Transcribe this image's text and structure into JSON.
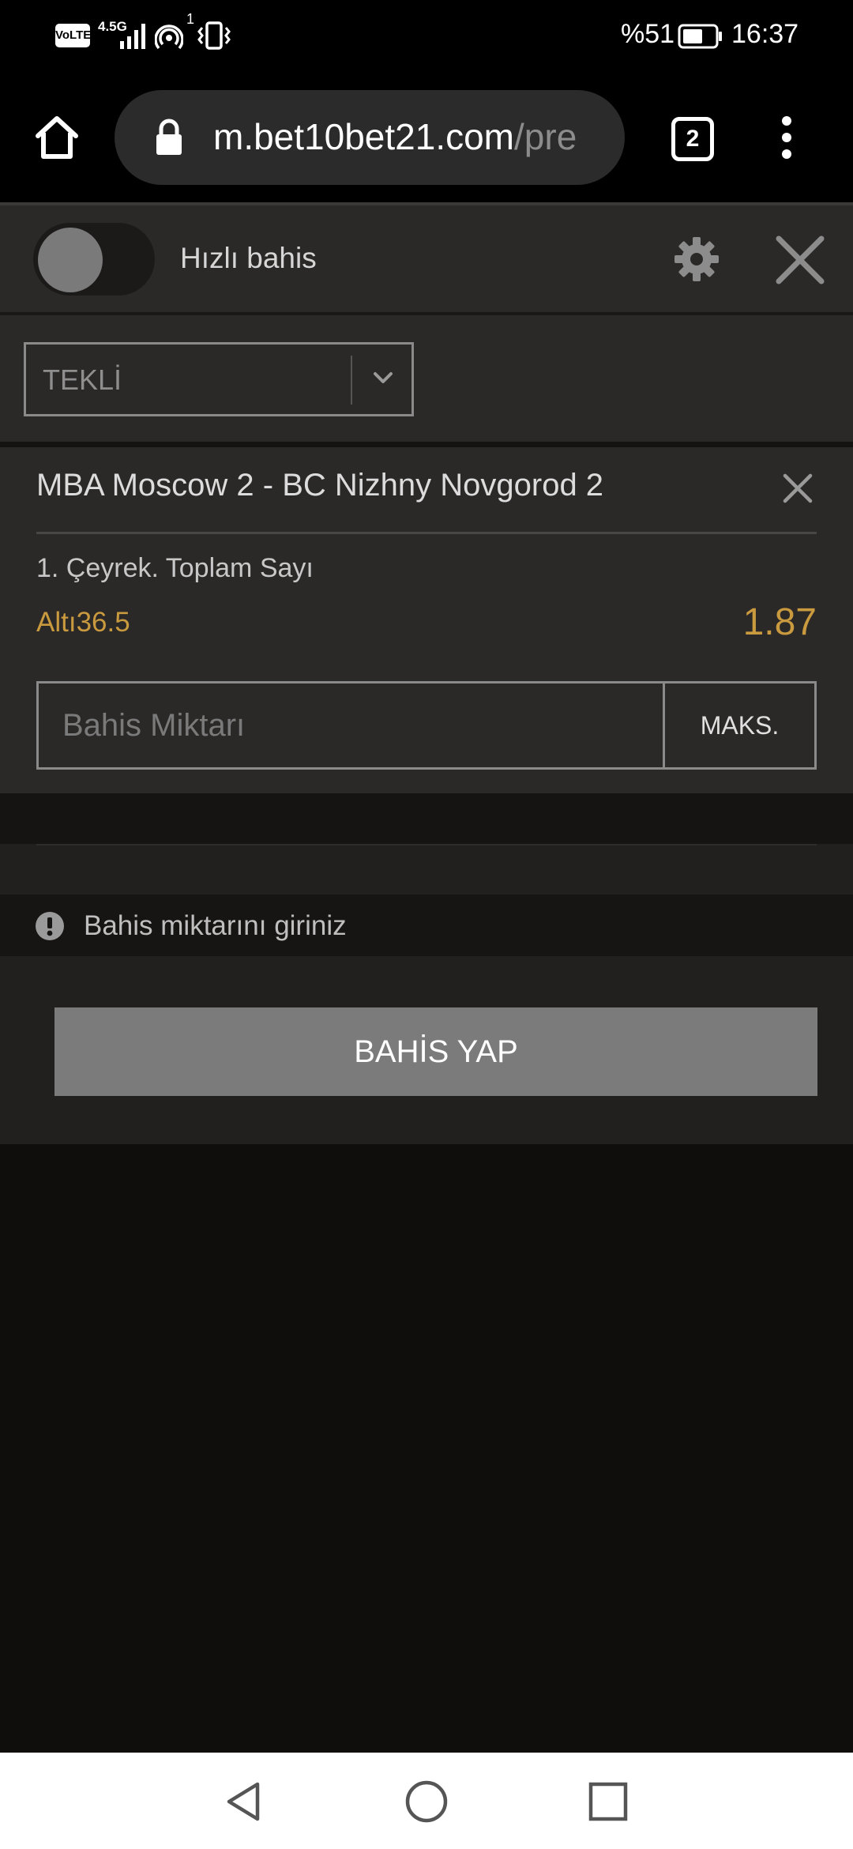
{
  "status_bar": {
    "volte": "VoLTE",
    "network": "4.5G",
    "hotspot_count": "1",
    "battery_percent": "%51",
    "time": "16:37"
  },
  "browser": {
    "url_host": "m.bet10bet21.com",
    "url_path": "/pre",
    "tab_count": "2"
  },
  "slip": {
    "quick_bet_label": "Hızlı bahis",
    "quick_bet_enabled": false,
    "bet_type": "TEKLİ",
    "match": "MBA Moscow 2 - BC Nizhny Novgorod 2",
    "market": "1. Çeyrek. Toplam Sayı",
    "selection": "Altı36.5",
    "odds": "1.87",
    "stake_placeholder": "Bahis Miktarı",
    "max_label": "MAKS.",
    "notice": "Bahis miktarını giriniz",
    "place_bet_label": "BAHİS YAP"
  },
  "colors": {
    "accent_gold": "#c99a3e",
    "panel": "#2b2828",
    "background": "#100d0d",
    "button_disabled": "#7b7b7b"
  }
}
